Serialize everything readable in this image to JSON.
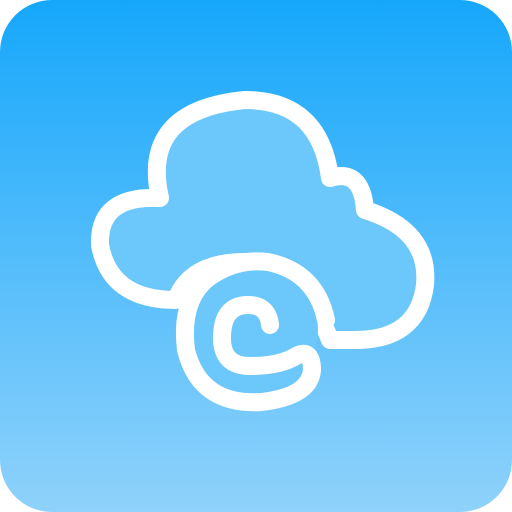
{
  "icon": {
    "name": "cloud-app-icon",
    "glyph": "cloud-icon",
    "letter_glyph": "c-swirl-icon",
    "colors": {
      "gradient_top": "#16a7fb",
      "gradient_bottom": "#8fd2fb",
      "cloud_fill": "#6cc7fb",
      "stroke": "#ffffff"
    }
  }
}
